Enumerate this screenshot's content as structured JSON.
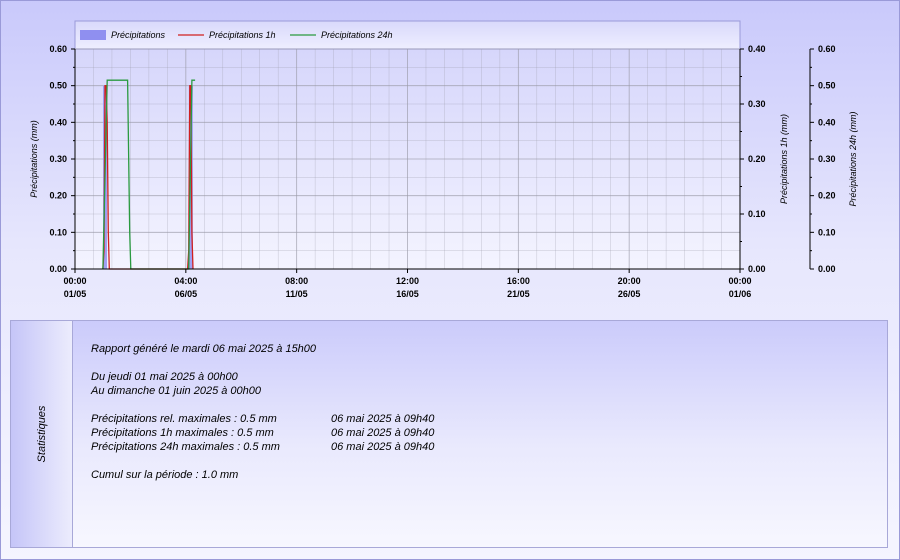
{
  "chart_data": {
    "type": "line",
    "title": "",
    "x_tick_labels": [
      [
        "00:00",
        "01/05"
      ],
      [
        "04:00",
        "06/05"
      ],
      [
        "08:00",
        "11/05"
      ],
      [
        "12:00",
        "16/05"
      ],
      [
        "16:00",
        "21/05"
      ],
      [
        "20:00",
        "26/05"
      ],
      [
        "00:00",
        "01/06"
      ]
    ],
    "x_range_days": [
      0,
      31
    ],
    "legend": {
      "position": "top-left",
      "entries": [
        "Précipitations",
        "Précipitations 1h",
        "Précipitations 24h"
      ]
    },
    "grid": true,
    "axes": [
      {
        "side": "left",
        "label": "Précipitations (mm)",
        "ylim": [
          0,
          0.6
        ],
        "ticks": [
          "0.00",
          "0.10",
          "0.20",
          "0.30",
          "0.40",
          "0.50",
          "0.60"
        ]
      },
      {
        "side": "right",
        "label": "Précipitations 1h (mm)",
        "ylim": [
          0,
          0.4
        ],
        "ticks": [
          "0.00",
          "0.10",
          "0.20",
          "0.30",
          "0.40"
        ]
      },
      {
        "side": "right",
        "label": "Précipitations 24h (mm)",
        "ylim": [
          0,
          0.6
        ],
        "ticks": [
          "0.00",
          "0.10",
          "0.20",
          "0.30",
          "0.40",
          "0.50",
          "0.60"
        ]
      }
    ],
    "series": [
      {
        "name": "Précipitations",
        "type": "bar",
        "color": "#8f8ff0",
        "axis": 0,
        "x": [
          1.4,
          5.4
        ],
        "y": [
          0.5,
          0.5
        ]
      },
      {
        "name": "Précipitations 1h",
        "type": "line",
        "color": "#d02020",
        "axis": 0,
        "x": [
          1.3,
          1.35,
          1.4,
          1.45,
          1.5,
          1.55,
          1.6,
          5.25,
          5.3,
          5.35,
          5.4,
          5.45,
          5.5
        ],
        "y": [
          0,
          0.05,
          0.5,
          0.5,
          0.4,
          0.1,
          0,
          0,
          0.05,
          0.5,
          0.5,
          0.1,
          0
        ]
      },
      {
        "name": "Précipitations 24h",
        "type": "line",
        "color": "#2a9a40",
        "axis": 0,
        "x": [
          1.3,
          1.5,
          2.45,
          2.55,
          2.6,
          5.3,
          5.45,
          5.6
        ],
        "y": [
          0,
          0.515,
          0.515,
          0.1,
          0,
          0,
          0.515,
          0.515
        ]
      }
    ]
  },
  "colors": {
    "bars": "#8f8ff0",
    "line_1h": "#d02020",
    "line_24h": "#2a9a40",
    "grid": "#9a9aa8"
  },
  "stats": {
    "panel_title": "Statistiques",
    "generated": "Rapport généré le mardi 06 mai 2025 à 15h00",
    "period_from": "Du jeudi 01 mai 2025 à 00h00",
    "period_to": "Au dimanche 01 juin 2025 à 00h00",
    "rows": [
      {
        "label": "Précipitations rel. maximales : 0.5 mm",
        "date": "06 mai 2025 à 09h40"
      },
      {
        "label": "Précipitations 1h maximales : 0.5 mm",
        "date": "06 mai 2025 à 09h40"
      },
      {
        "label": "Précipitations 24h maximales : 0.5 mm",
        "date": "06 mai 2025 à 09h40"
      }
    ],
    "cumul": "Cumul sur la période : 1.0 mm"
  }
}
